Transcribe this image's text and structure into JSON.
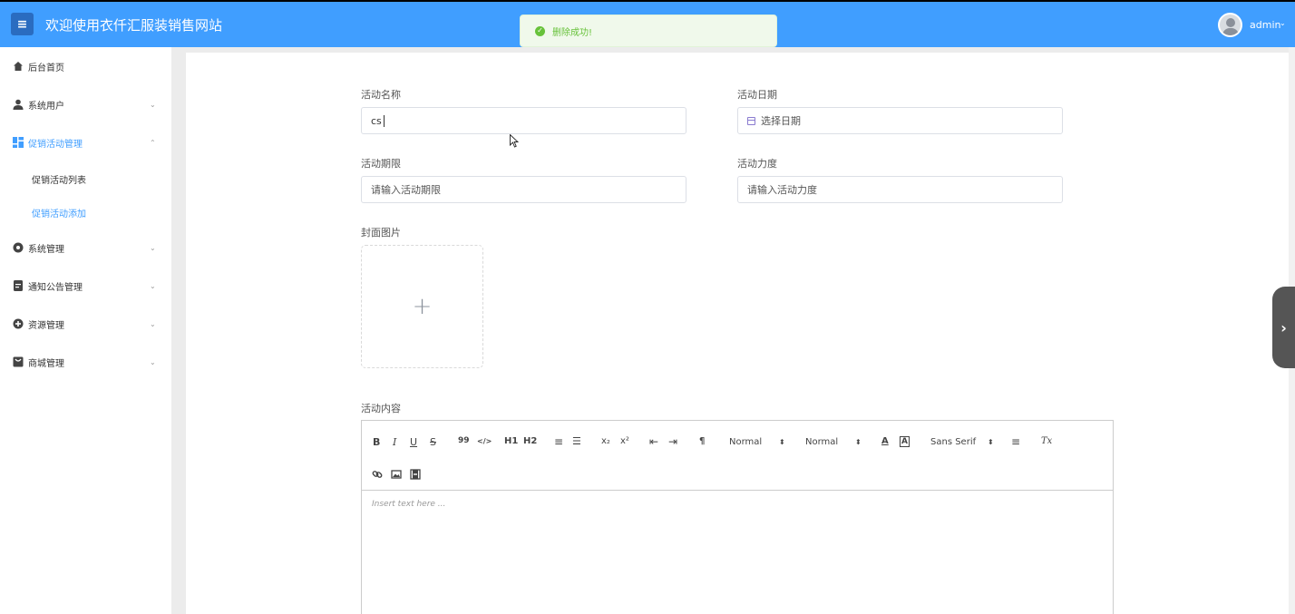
{
  "header": {
    "menu_icon": "hamburger-icon",
    "title": "欢迎使用衣仟汇服装销售网站",
    "toast_message": "删除成功!",
    "user_name": "admin",
    "user_caret": "⌄",
    "accent_color": "#409eff",
    "success_color": "#67c23a"
  },
  "sidebar": {
    "items": [
      {
        "label": "后台首页",
        "icon": "home-icon"
      },
      {
        "label": "系统用户",
        "icon": "user-icon"
      },
      {
        "label": "促销活动管理",
        "icon": "grid-icon"
      },
      {
        "label": "系统管理",
        "icon": "gear-icon"
      },
      {
        "label": "通知公告管理",
        "icon": "notice-icon"
      },
      {
        "label": "资源管理",
        "icon": "resource-icon"
      },
      {
        "label": "商城管理",
        "icon": "shop-icon"
      }
    ],
    "sub_items": [
      {
        "label": "促销活动列表"
      },
      {
        "label": "促销活动添加"
      }
    ],
    "arrow_down": "⌄",
    "arrow_up": "⌃"
  },
  "form": {
    "activity_name_label": "活动名称",
    "activity_name_value": "cs",
    "activity_date_label": "活动日期",
    "activity_date_placeholder": "选择日期",
    "activity_period_label": "活动期限",
    "activity_period_placeholder": "请输入活动期限",
    "activity_strength_label": "活动力度",
    "activity_strength_placeholder": "请输入活动力度",
    "cover_label": "封面图片",
    "upload_plus": "+",
    "content_label": "活动内容"
  },
  "editor": {
    "bold": "B",
    "italic": "I",
    "underline": "U",
    "strike": "S",
    "quote": "99",
    "code": "</>",
    "h1": "H1",
    "h2": "H2",
    "ordered_list": "≡",
    "bullet_list": "☰",
    "sub": "x₂",
    "sup": "x²",
    "indent_less": "⇤",
    "indent_more": "⇥",
    "direction": "¶",
    "size_select": "Normal",
    "header_select": "Normal",
    "color": "A",
    "background": "A",
    "font_select": "Sans Serif",
    "align": "≡",
    "clean": "Tx",
    "select_arrow": "⬍",
    "placeholder": "Insert text here ..."
  },
  "side_tab_arrow": "›"
}
